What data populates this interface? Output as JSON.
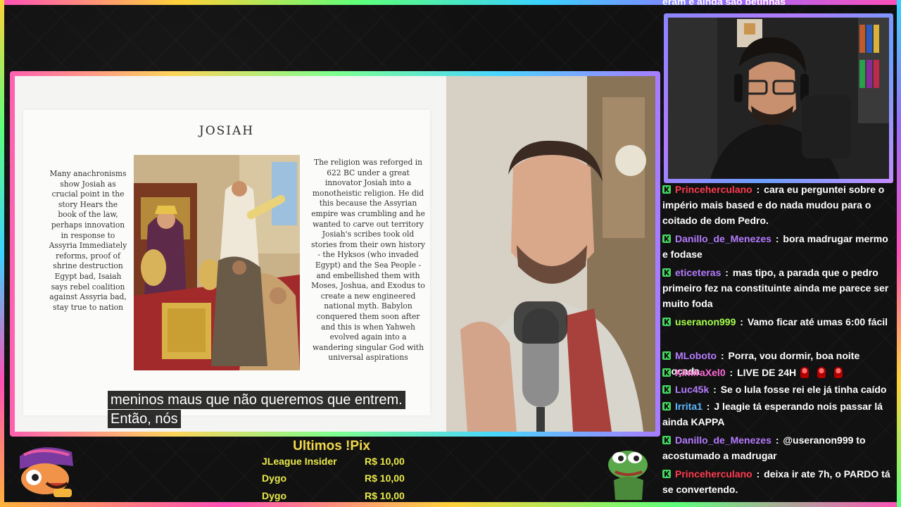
{
  "slide": {
    "title": "JOSIAH",
    "left_text": "Many anachronisms show Josiah as crucial point in the story Hears the book of the law, perhaps innovation in response to Assyria Immediately reforms, proof of shrine destruction Egypt bad, Isaiah says rebel coalition against Assyria bad, stay true to nation",
    "right_text": "The religion was reforged in 622 BC under a great innovator Josiah into a monotheistic religion. He did this because the Assyrian empire was crumbling and he wanted to carve out territory Josiah's scribes took old stories from their own history - the Hyksos (who invaded Egypt) and the Sea People - and embellished them with Moses, Joshua, and Exodus to create a new engineered national myth. Babylon conquered them soon after and this is when Yahweh evolved again into a wandering singular God with universal aspirations"
  },
  "subtitles": {
    "line1": "meninos maus que não queremos que entrem.",
    "line2": "Então, nós"
  },
  "chat": {
    "top_partial": "eram e ainda são betinhas",
    "messages": [
      {
        "user": "Princeherculano",
        "user_color": "#ff3b4e",
        "badge_color": "#46d660",
        "text": "cara eu perguntei sobre o império mais based e do nada mudou para o coitado de dom Pedro."
      },
      {
        "user": "Danillo_de_Menezes",
        "user_color": "#b57bff",
        "badge_color": "#46d660",
        "text": "bora madrugar mermo e fodase"
      },
      {
        "user": "eticeteras",
        "user_color": "#b57bff",
        "badge_color": "#46d660",
        "text": "mas tipo, a parada que o pedro primeiro fez na constituinte ainda me parece ser muito foda"
      },
      {
        "user": "useranon999",
        "user_color": "#a6ff4d",
        "badge_color": "#46d660",
        "text": "Vamo ficar até umas 6:00 fácil"
      },
      {
        "user": "MLoboto",
        "user_color": "#b57bff",
        "badge_color": "#46d660",
        "text": "Porra, vou dormir, boa noite moçada"
      },
      {
        "user": "XimiraXel0",
        "user_color": "#ff6bd6",
        "badge_color": "#46d660",
        "text": "LIVE DE 24H"
      },
      {
        "user": "Luc45k",
        "user_color": "#b57bff",
        "badge_color": "#46d660",
        "text": "Se o lula fosse rei ele já tinha caído"
      },
      {
        "user": "Irrita1",
        "user_color": "#5fb8ff",
        "badge_color": "#46d660",
        "text": "J leagie tá esperando nois passar lá ainda KAPPA"
      },
      {
        "user": "Danillo_de_Menezes",
        "user_color": "#b57bff",
        "badge_color": "#46d660",
        "text": "@useranon999 to acostumado a madrugar"
      },
      {
        "user": "Princeherculano",
        "user_color": "#ff3b4e",
        "badge_color": "#46d660",
        "text": "deixa ir ate 7h, o PARDO tá se convertendo."
      }
    ]
  },
  "pix": {
    "title": "Ultimos !Pix",
    "rows": [
      {
        "name": "JLeague Insider",
        "amount": "R$ 10,00"
      },
      {
        "name": "Dygo",
        "amount": "R$ 10,00"
      },
      {
        "name": "Dygo",
        "amount": "R$ 10,00"
      }
    ]
  }
}
